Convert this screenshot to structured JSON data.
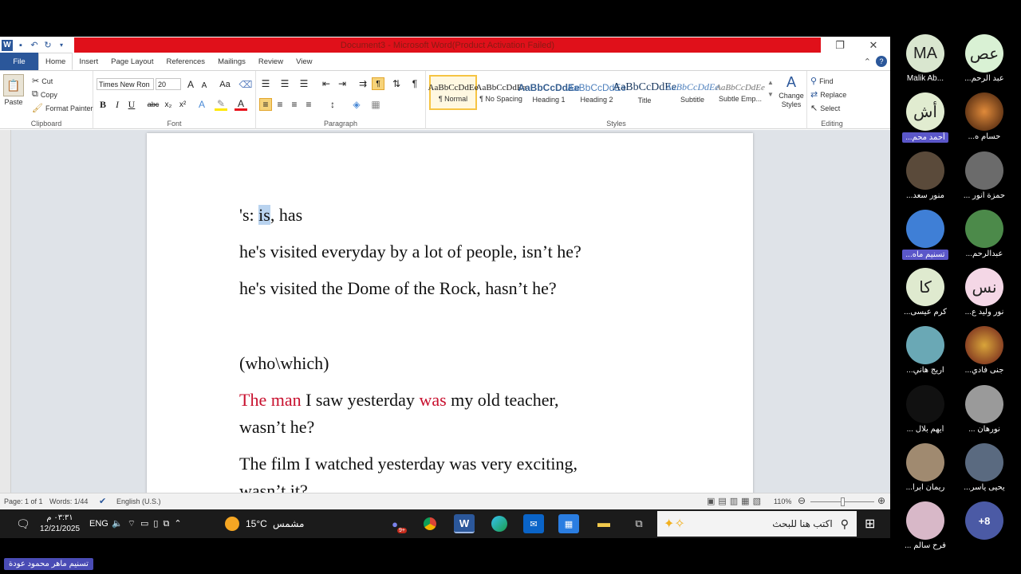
{
  "window": {
    "title": "Document3 - Microsoft Word(Product Activation Failed)"
  },
  "tabs": [
    "File",
    "Home",
    "Insert",
    "Page Layout",
    "References",
    "Mailings",
    "Review",
    "View"
  ],
  "clipboard": {
    "paste": "Paste",
    "cut": "Cut",
    "copy": "Copy",
    "format_painter": "Format Painter",
    "label": "Clipboard"
  },
  "font": {
    "family": "Times New Ron",
    "size": "20",
    "label": "Font",
    "bold": "B",
    "italic": "I",
    "underline": "U",
    "strike": "abc",
    "sub": "x₂",
    "sup": "x²",
    "grow": "A",
    "shrink": "A",
    "case": "Aa"
  },
  "paragraph": {
    "label": "Paragraph",
    "pilcrow": "¶"
  },
  "styles": {
    "label": "Styles",
    "items": [
      {
        "preview": "AaBbCcDdEe",
        "name": "¶ Normal"
      },
      {
        "preview": "AaBbCcDdEe",
        "name": "¶ No Spacing"
      },
      {
        "preview": "AaBbCcDdEe",
        "name": "Heading 1"
      },
      {
        "preview": "AaBbCcDdEe",
        "name": "Heading 2"
      },
      {
        "preview": "AaBbCcDdEe",
        "name": "Title"
      },
      {
        "preview": "AaBbCcDdEe",
        "name": "Subtitle"
      },
      {
        "preview": "AaBbCcDdEe",
        "name": "Subtle Emp..."
      }
    ],
    "change_styles": "Change Styles"
  },
  "editing": {
    "label": "Editing",
    "find": "Find",
    "replace": "Replace",
    "select": "Select"
  },
  "document": {
    "line1_pre": "'s: ",
    "line1_hl": "is",
    "line1_post": ", has",
    "line2": "he's visited everyday by a lot of people, isn’t he?",
    "line3": "he's visited the Dome of the Rock, hasn’t he?",
    "line4": "(who\\which)",
    "line5_red1": "The man",
    "line5_mid": " I saw yesterday ",
    "line5_red2": "was",
    "line5_post": " my old teacher,",
    "line6": "wasn’t he?",
    "line7": "The film I watched yesterday was very exciting,",
    "line8": "wasn’t it?"
  },
  "status": {
    "page": "Page: 1 of 1",
    "words": "Words: 1/44",
    "language": "English (U.S.)",
    "zoom": "110%"
  },
  "taskbar": {
    "time": "٠٣:٣١ م",
    "date": "12/21/2025",
    "lang": "ENG",
    "weather_temp": "15°C",
    "weather_text": "مشمس",
    "search_placeholder": "اكتب هنا للبحث",
    "badge": "9+"
  },
  "participants": [
    {
      "initials": "MA",
      "name": "Malik Ab...",
      "color": "#d9e6cf"
    },
    {
      "initials": "عص",
      "name": "...عبد الرحم",
      "color": "#d9f1d4"
    },
    {
      "initials": "أش",
      "name": "...أحمد محم",
      "color": "#e1ecd0",
      "tag": true
    },
    {
      "initials": "",
      "name": "...حسام ه",
      "color": "#7a3a1a"
    },
    {
      "initials": "",
      "name": "...منور سعد",
      "color": "#5a4a3a"
    },
    {
      "initials": "",
      "name": "... حمزة أنور",
      "color": "#6b6b6b"
    },
    {
      "initials": "",
      "name": "...تسنيم ماه",
      "color": "#3f7fd6",
      "tag": true
    },
    {
      "initials": "",
      "name": "...عبدالرحم",
      "color": "#4c8a4a"
    },
    {
      "initials": "كا",
      "name": "...كرم عيسى",
      "color": "#dfeacf"
    },
    {
      "initials": "نس",
      "name": "...نور وليد ع",
      "color": "#f4d7e6"
    },
    {
      "initials": "",
      "name": "...اريج هاني",
      "color": "#6aa8b5"
    },
    {
      "initials": "",
      "name": "...جنى فادي",
      "color": "#6a3a2a"
    },
    {
      "initials": "",
      "name": "... أيهم بلال",
      "color": "#111111"
    },
    {
      "initials": "",
      "name": "... نورهان",
      "color": "#9a9a9a"
    },
    {
      "initials": "",
      "name": "...ريمان ابرا",
      "color": "#a08a70"
    },
    {
      "initials": "",
      "name": "...يحيى ياسر",
      "color": "#5a6a80"
    },
    {
      "initials": "",
      "name": "... فرح سالم",
      "color": "#d8b8c8"
    },
    {
      "initials": "+8",
      "name": "",
      "color": "#4b5aa5"
    }
  ],
  "bottom_label": "تسنيم ماهر محمود عودة"
}
